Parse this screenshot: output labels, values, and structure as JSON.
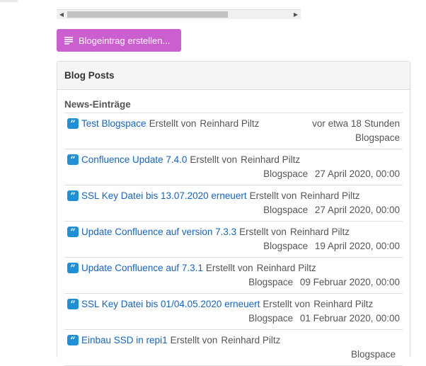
{
  "toolbar": {
    "create_label": "Blogeintrag erstellen...",
    "accent_color": "#cc5fcf"
  },
  "panel": {
    "title": "Blog Posts",
    "section_title": "News-Einträge"
  },
  "posts": [
    {
      "title": "Test Blogspace",
      "created_by_label": "Erstellt von",
      "author": "Reinhard Piltz",
      "space": "Blogspace",
      "date": "vor etwa 18 Stunden"
    },
    {
      "title": "Confluence Update 7.4.0",
      "created_by_label": "Erstellt von",
      "author": "Reinhard Piltz",
      "space": "Blogspace",
      "date": "27 April 2020, 00:00"
    },
    {
      "title": "SSL Key Datei bis 13.07.2020 erneuert",
      "created_by_label": "Erstellt von",
      "author": "Reinhard Piltz",
      "space": "Blogspace",
      "date": "27 April 2020, 00:00"
    },
    {
      "title": "Update Confluence auf version 7.3.3",
      "created_by_label": "Erstellt von",
      "author": "Reinhard Piltz",
      "space": "Blogspace",
      "date": "19 April 2020, 00:00"
    },
    {
      "title": "Update Confluence auf 7.3.1",
      "created_by_label": "Erstellt von",
      "author": "Reinhard Piltz",
      "space": "Blogspace",
      "date": "09 Februar 2020, 00:00"
    },
    {
      "title": "SSL Key Datei bis 01/04.05.2020 erneuert",
      "created_by_label": "Erstellt von",
      "author": "Reinhard Piltz",
      "space": "Blogspace",
      "date": "01 Februar 2020, 00:00"
    },
    {
      "title": "Einbau SSD in repi1",
      "created_by_label": "Erstellt von",
      "author": "Reinhard Piltz",
      "space": "Blogspace",
      "date": ""
    }
  ],
  "icons": {
    "post": "quote-icon",
    "create": "text-lines-icon",
    "scroll_left": "arrow-left-icon",
    "scroll_right": "arrow-right-icon"
  }
}
